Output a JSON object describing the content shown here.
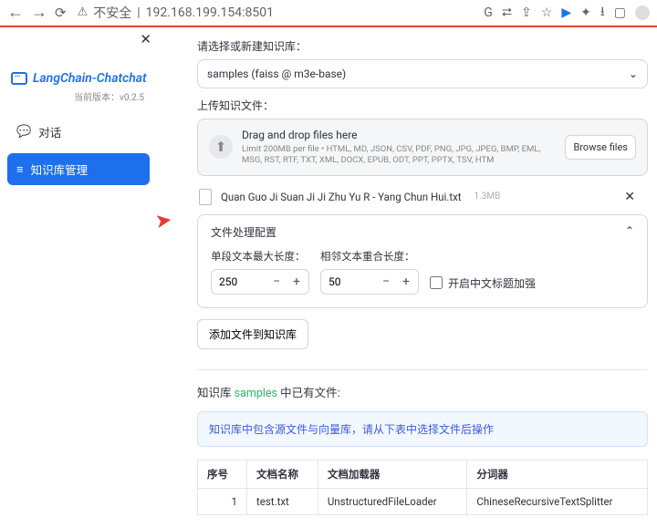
{
  "browser": {
    "insecure_label": "不安全",
    "url": "192.168.199.154:8501"
  },
  "brand": "LangChain-Chatchat",
  "version_label": "当前版本：v0.2.5",
  "nav": {
    "chat": "对话",
    "kb": "知识库管理"
  },
  "select_label": "请选择或新建知识库：",
  "select_value": "samples (faiss @ m3e-base)",
  "upload_label": "上传知识文件：",
  "dropzone": {
    "heading": "Drag and drop files here",
    "sub": "Limit 200MB per file • HTML, MD, JSON, CSV, PDF, PNG, JPG, JPEG, BMP, EML, MSG, RST, RTF, TXT, XML, DOCX, EPUB, ODT, PPT, PPTX, TSV, HTM",
    "browse": "Browse files"
  },
  "file": {
    "name": "Quan Guo Ji Suan Ji Ji Zhu Yu R - Yang Chun Hui.txt",
    "size": "1.3MB"
  },
  "panel": {
    "title": "文件处理配置",
    "max_len_label": "单段文本最大长度：",
    "max_len_value": "250",
    "overlap_label": "相邻文本重合长度：",
    "overlap_value": "50",
    "cn_title_enhance": "开启中文标题加强"
  },
  "add_button": "添加文件到知识库",
  "existing": {
    "prefix": "知识库",
    "name": "samples",
    "suffix": "中已有文件:"
  },
  "infobox": "知识库中包含源文件与向量库，请从下表中选择文件后操作",
  "table": {
    "headers": {
      "idx": "序号",
      "name": "文档名称",
      "loader": "文档加载器",
      "splitter": "分词器"
    },
    "rows": [
      {
        "idx": "1",
        "name": "test.txt",
        "loader": "UnstructuredFileLoader",
        "splitter": "ChineseRecursiveTextSplitter"
      }
    ]
  }
}
